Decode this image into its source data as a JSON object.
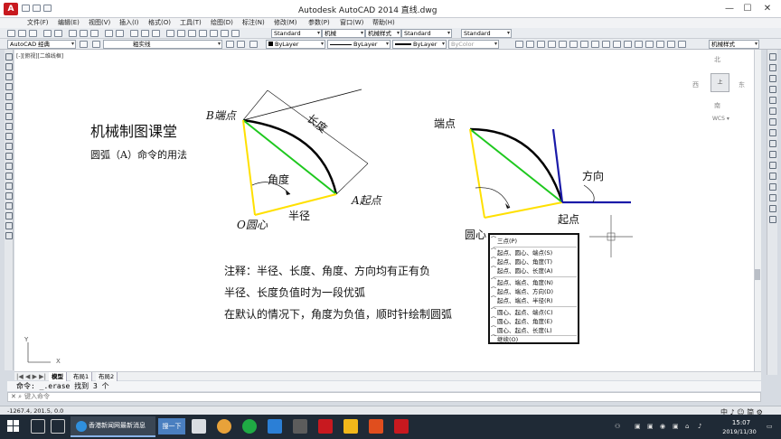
{
  "window": {
    "title": "Autodesk AutoCAD 2014    直线.dwg",
    "logo_letter": "A",
    "controls": {
      "minimize": "—",
      "maximize": "☐",
      "close": "✕"
    }
  },
  "menu": [
    "文件(F)",
    "编辑(E)",
    "视图(V)",
    "插入(I)",
    "格式(O)",
    "工具(T)",
    "绘图(D)",
    "标注(N)",
    "修改(M)",
    "参数(P)",
    "窗口(W)",
    "帮助(H)"
  ],
  "toolbar1": {
    "text_style": "Standard",
    "dim_style": "机械",
    "dim_style_label": "机械样式",
    "table_style": "Standard"
  },
  "toolbar2": {
    "workspace": "AutoCAD 经典",
    "layer": "粗实线",
    "color": "ByLayer",
    "linetype": "ByLayer",
    "lineweight": "ByLayer",
    "plotstyle": "ByColor",
    "multileader_style": "机械样式"
  },
  "viewport_label": "[-][俯视][二维线框]",
  "viewcube": {
    "north": "北",
    "south": "南",
    "east": "东",
    "west": "西",
    "top": "上",
    "wcs": "WCS ▾"
  },
  "drawing": {
    "title": "机械制图课堂",
    "subtitle": "圆弧（A）命令的用法",
    "left_figure": {
      "b_end": "B端点",
      "length": "长度",
      "angle": "角度",
      "a_start": "A起点",
      "radius": "半径",
      "o_center": "O圆心"
    },
    "right_figure": {
      "end": "端点",
      "direction": "方向",
      "start": "起点",
      "center": "圆心"
    },
    "notes": [
      "注释：半径、长度、角度、方向均有正有负",
      "半径、长度负值时为一段优弧",
      "在默认的情况下，角度为负值，顺时针绘制圆弧"
    ],
    "ucs": {
      "y": "Y",
      "x": "X"
    }
  },
  "arc_menu": [
    "三点(P)",
    "起点、圆心、端点(S)",
    "起点、圆心、角度(T)",
    "起点、圆心、长度(A)",
    "起点、端点、角度(N)",
    "起点、端点、方向(D)",
    "起点、端点、半径(R)",
    "圆心、起点、端点(C)",
    "圆心、起点、角度(E)",
    "圆心、起点、长度(L)",
    "继续(O)"
  ],
  "tabs": [
    "模型",
    "布局1",
    "布局2"
  ],
  "command": {
    "history": "命令:  _.erase 找到 3 个",
    "placeholder": "键入命令"
  },
  "status": {
    "coords": "-1267.4, 201.5, 0.0"
  },
  "taskbar": {
    "browser_task": "香港新闻网最新消息",
    "search": "搜一下",
    "ime": "中 ♪ ☺ 简 ⚙",
    "time": "15:07",
    "date": "2019/11/30"
  }
}
